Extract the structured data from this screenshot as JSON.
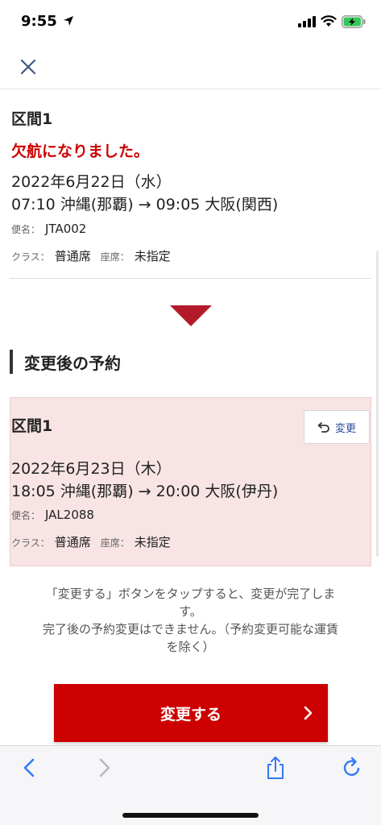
{
  "status_bar": {
    "time": "9:55"
  },
  "header": {
    "close_icon": "close-icon"
  },
  "original_segment": {
    "title": "区間1",
    "cancel_notice": "欠航になりました。",
    "date": "2022年6月22日（水）",
    "route": "07:10 沖縄(那覇) → 09:05 大阪(関西)",
    "flight_label": "便名：",
    "flight_number": "JTA002",
    "class_label": "クラス：",
    "class_value": "普通席",
    "seat_label": "座席：",
    "seat_value": "未指定"
  },
  "new_section": {
    "heading": "変更後の予約"
  },
  "new_segment": {
    "title": "区間1",
    "change_label": "変更",
    "date": "2022年6月23日（木）",
    "route": "18:05 沖縄(那覇) → 20:00 大阪(伊丹)",
    "flight_label": "便名：",
    "flight_number": "JAL2088",
    "class_label": "クラス：",
    "class_value": "普通席",
    "seat_label": "座席：",
    "seat_value": "未指定"
  },
  "notice": {
    "line1": "「変更する」ボタンをタップすると、変更が完了しま",
    "line2": "す。",
    "line3": "完了後の予約変更はできません。（予約変更可能な運賃",
    "line4": "を除く）"
  },
  "confirm_button": {
    "label": "変更する"
  },
  "colors": {
    "accent_red": "#cc0000",
    "triangle_red": "#b31b2b",
    "highlight_bg": "#f8e4e4",
    "link_blue": "#2b4a9a",
    "safari_blue": "#3478f6"
  }
}
